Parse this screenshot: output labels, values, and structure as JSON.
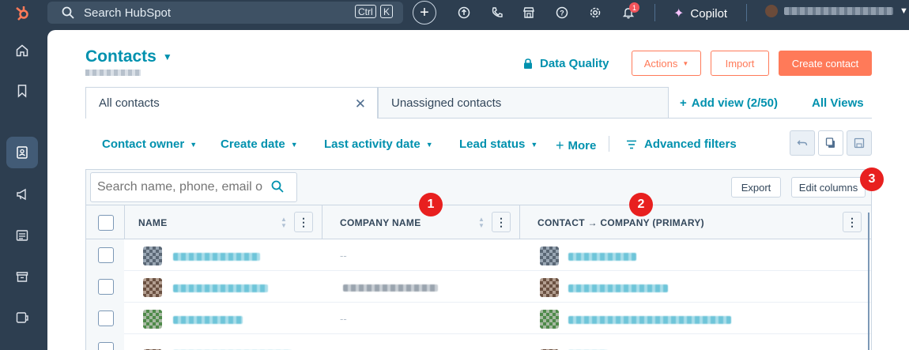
{
  "topbar": {
    "search_label": "Search HubSpot",
    "kbd_ctrl": "Ctrl",
    "kbd_k": "K",
    "notifications_badge": "1",
    "copilot_label": "Copilot"
  },
  "header": {
    "title": "Contacts",
    "data_quality_label": "Data Quality",
    "actions_label": "Actions",
    "import_label": "Import",
    "create_contact_label": "Create contact"
  },
  "view_tabs": {
    "tabs": [
      {
        "label": "All contacts"
      },
      {
        "label": "Unassigned contacts"
      }
    ],
    "add_view_label": "Add view (2/50)",
    "all_views_label": "All Views"
  },
  "filters": {
    "contact_owner": "Contact owner",
    "create_date": "Create date",
    "last_activity_date": "Last activity date",
    "lead_status": "Lead status",
    "more": "More",
    "advanced_filters": "Advanced filters"
  },
  "table": {
    "search_placeholder": "Search name, phone, email o",
    "export_label": "Export",
    "edit_columns_label": "Edit columns",
    "columns": [
      "NAME",
      "COMPANY NAME",
      "CONTACT → COMPANY (PRIMARY)"
    ],
    "empty_value": "--"
  },
  "annotations": [
    "1",
    "2",
    "3"
  ],
  "colors": {
    "accent": "#0091ae",
    "brand": "#ff7a59",
    "nav_bg": "#2d3e50",
    "marker": "#e8201f"
  }
}
